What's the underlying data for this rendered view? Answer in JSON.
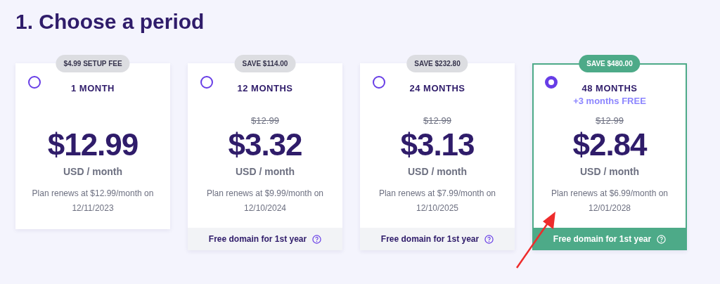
{
  "heading": "1. Choose a period",
  "plans": [
    {
      "badge": "$4.99 SETUP FEE",
      "period": "1 MONTH",
      "price": "$12.99",
      "unit": "USD / month",
      "renews": "Plan renews at $12.99/month on",
      "renew_date": "12/11/2023",
      "selected": false
    },
    {
      "badge": "SAVE $114.00",
      "period": "12 MONTHS",
      "old_price": "$12.99",
      "price": "$3.32",
      "unit": "USD / month",
      "renews": "Plan renews at $9.99/month on",
      "renew_date": "12/10/2024",
      "footer": "Free domain for 1st year",
      "selected": false
    },
    {
      "badge": "SAVE $232.80",
      "period": "24 MONTHS",
      "old_price": "$12.99",
      "price": "$3.13",
      "unit": "USD / month",
      "renews": "Plan renews at $7.99/month on",
      "renew_date": "12/10/2025",
      "footer": "Free domain for 1st year",
      "selected": false
    },
    {
      "badge": "SAVE $480.00",
      "period": "48 MONTHS",
      "extra": "+3 months FREE",
      "old_price": "$12.99",
      "price": "$2.84",
      "unit": "USD / month",
      "renews": "Plan renews at $6.99/month on",
      "renew_date": "12/01/2028",
      "footer": "Free domain for 1st year",
      "selected": true
    }
  ]
}
